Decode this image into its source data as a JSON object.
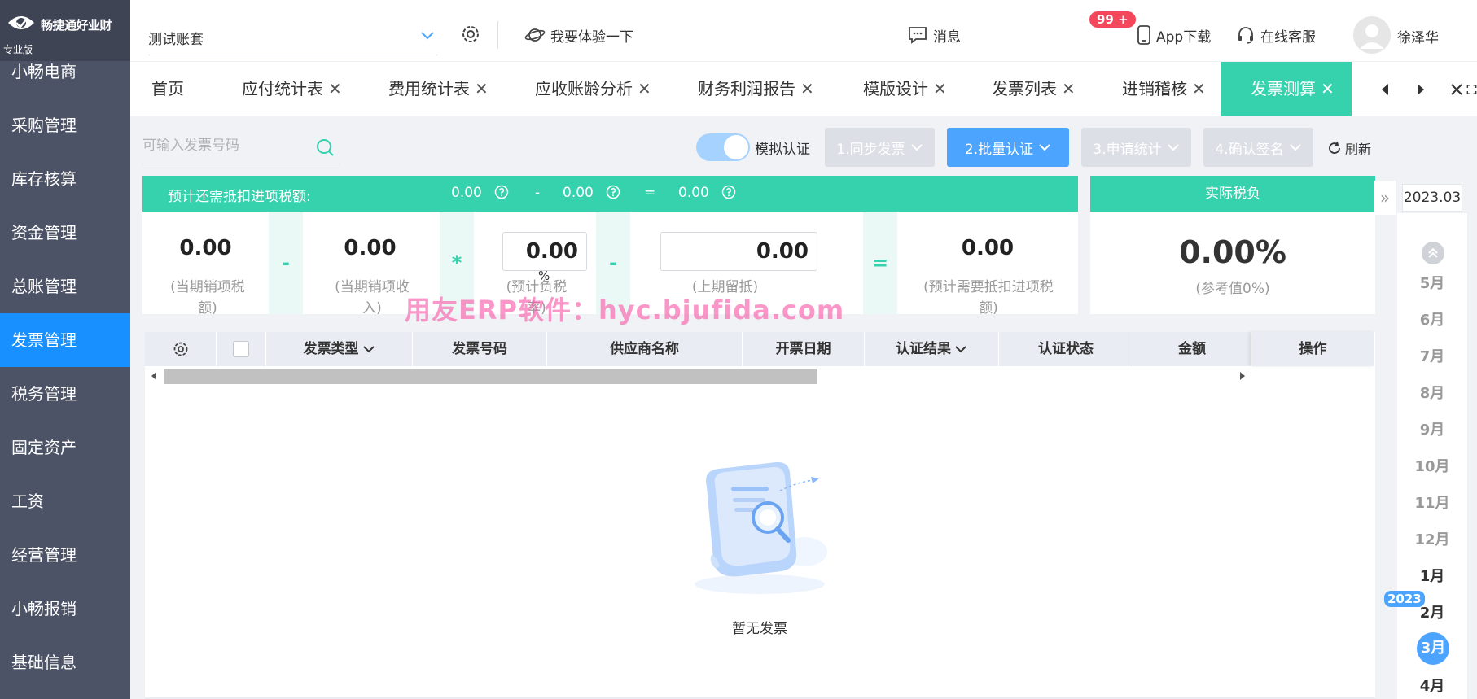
{
  "brand": {
    "name": "畅捷通好业财",
    "edition": "专业版"
  },
  "sidebar": {
    "items": [
      {
        "label": "小畅电商",
        "active": false
      },
      {
        "label": "采购管理",
        "active": false
      },
      {
        "label": "库存核算",
        "active": false
      },
      {
        "label": "资金管理",
        "active": false
      },
      {
        "label": "总账管理",
        "active": false
      },
      {
        "label": "发票管理",
        "active": true
      },
      {
        "label": "税务管理",
        "active": false
      },
      {
        "label": "固定资产",
        "active": false
      },
      {
        "label": "工资",
        "active": false
      },
      {
        "label": "经营管理",
        "active": false
      },
      {
        "label": "小畅报销",
        "active": false
      },
      {
        "label": "基础信息",
        "active": false
      }
    ]
  },
  "topbar": {
    "account": "测试账套",
    "try_label": "我要体验一下",
    "messages_label": "消息",
    "messages_badge": "99 +",
    "app_label": "App下载",
    "support_label": "在线客服",
    "user_name": "徐泽华"
  },
  "tabs": [
    {
      "label": "首页",
      "closable": false
    },
    {
      "label": "应付统计表",
      "closable": true
    },
    {
      "label": "费用统计表",
      "closable": true
    },
    {
      "label": "应收账龄分析",
      "closable": true
    },
    {
      "label": "财务利润报告",
      "closable": true
    },
    {
      "label": "模版设计",
      "closable": true
    },
    {
      "label": "发票列表",
      "closable": true
    },
    {
      "label": "进销稽核",
      "closable": true
    },
    {
      "label": "发票测算",
      "closable": true,
      "active": true
    }
  ],
  "toolbar": {
    "search_placeholder": "可输入发票号码",
    "simulate_label": "模拟认证",
    "simulate_on": true,
    "steps": [
      {
        "label": "1.同步发票",
        "state": "disabled"
      },
      {
        "label": "2.批量认证",
        "state": "primary"
      },
      {
        "label": "3.申请统计",
        "state": "disabled"
      },
      {
        "label": "4.确认签名",
        "state": "disabled"
      }
    ],
    "refresh_label": "刷新"
  },
  "formula": {
    "title": "预计还需抵扣进项税额:",
    "summary": {
      "a": "0.00",
      "minus": "-",
      "b": "0.00",
      "equals": "=",
      "c": "0.00"
    },
    "output_tax": {
      "value": "0.00",
      "caption": "(当期销项税额)"
    },
    "op1": "-",
    "sales_revenue": {
      "value": "0.00",
      "caption": "(当期销项收入)"
    },
    "op2": "*",
    "burden_rate": {
      "value": "0.00",
      "unit": "%",
      "caption": "(预计负税率)"
    },
    "op3": "-",
    "carryover": {
      "value": "0.00",
      "caption": "(上期留抵)"
    },
    "op4": "=",
    "result": {
      "value": "0.00",
      "caption": "(预计需要抵扣进项税额)"
    }
  },
  "actual_tax": {
    "title": "实际税负",
    "value": "0.00%",
    "caption": "(参考值0%)"
  },
  "watermark": "用友ERP软件：hyc.bjufida.com",
  "table": {
    "columns": [
      {
        "label": "",
        "kind": "settings"
      },
      {
        "label": "",
        "kind": "checkbox"
      },
      {
        "label": "发票类型",
        "dropdown": true
      },
      {
        "label": "发票号码"
      },
      {
        "label": "供应商名称"
      },
      {
        "label": "开票日期"
      },
      {
        "label": "认证结果",
        "dropdown": true
      },
      {
        "label": "认证状态"
      },
      {
        "label": "金额"
      },
      {
        "label": "操作"
      }
    ],
    "rows": [],
    "empty_text": "暂无发票"
  },
  "period": {
    "selected": "2023.03",
    "months": [
      {
        "label": "5月",
        "current_year": false
      },
      {
        "label": "6月",
        "current_year": false
      },
      {
        "label": "7月",
        "current_year": false
      },
      {
        "label": "8月",
        "current_year": false
      },
      {
        "label": "9月",
        "current_year": false
      },
      {
        "label": "10月",
        "current_year": false
      },
      {
        "label": "11月",
        "current_year": false
      },
      {
        "label": "12月",
        "current_year": false
      },
      {
        "label": "1月",
        "current_year": true
      },
      {
        "label": "2月",
        "current_year": true
      },
      {
        "label": "3月",
        "current_year": true,
        "selected": true
      },
      {
        "label": "4月",
        "current_year": true
      }
    ],
    "year_marker": "2023"
  },
  "colors": {
    "sidebar_bg": "#4d5366",
    "active_blue": "#1890ff",
    "accent_green": "#36d2ae",
    "primary_button": "#4ca4ff",
    "badge_red": "#f5475c",
    "watermark_pink": "#f75faa"
  },
  "icons": {
    "logo": "brand-eye-logo-icon",
    "settings": "gear-icon",
    "try": "planet-icon",
    "messages": "chat-bubble-icon",
    "app": "phone-icon",
    "support": "headset-icon",
    "search": "search-icon",
    "refresh": "refresh-icon",
    "help": "question-circle-icon",
    "empty": "empty-invoice-illustration"
  }
}
